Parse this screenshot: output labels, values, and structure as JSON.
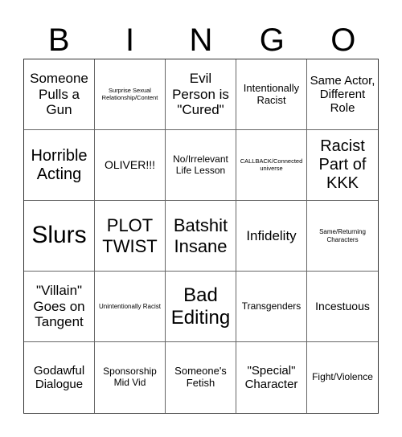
{
  "header": {
    "letters": [
      "B",
      "I",
      "N",
      "G",
      "O"
    ]
  },
  "board": {
    "rows": [
      [
        "Someone Pulls a Gun",
        "Surprise Sexual Relationship/Content",
        "Evil Person is \"Cured\"",
        "Intentionally Racist",
        "Same Actor, Different Role"
      ],
      [
        "Horrible Acting",
        "OLIVER!!!",
        "No/Irrelevant Life Lesson",
        "CALLBACK/Connected universe",
        "Racist Part of KKK"
      ],
      [
        "Slurs",
        "PLOT TWIST",
        "Batshit Insane",
        "Infidelity",
        "Same/Returning Characters"
      ],
      [
        "\"Villain\" Goes on Tangent",
        "Unintentionally Racist",
        "Bad Editing",
        "Transgenders",
        "Incestuous"
      ],
      [
        "Godawful Dialogue",
        "Sponsorship Mid Vid",
        "Someone's Fetish",
        "\"Special\" Character",
        "Fight/Violence"
      ]
    ]
  }
}
